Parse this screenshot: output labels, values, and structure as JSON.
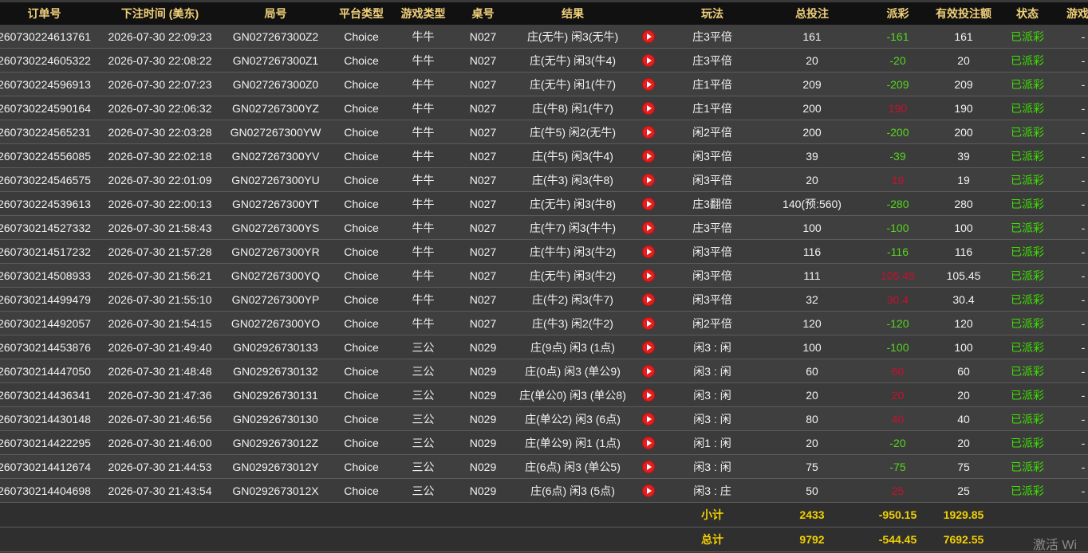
{
  "columns": [
    "订单号",
    "下注时间 (美东)",
    "局号",
    "平台类型",
    "游戏类型",
    "桌号",
    "结果",
    "",
    "玩法",
    "总投注",
    "派彩",
    "有效投注额",
    "状态",
    "游戏模"
  ],
  "rows": [
    {
      "order": "260730224613761",
      "time": "2026-07-30 22:09:23",
      "round": "GN027267300Z2",
      "platform": "Choice",
      "game": "牛牛",
      "table": "N027",
      "result": "庄(无牛) 闲3(无牛)",
      "play": "庄3平倍",
      "bet": "161",
      "payout": "-161",
      "payout_sign": "neg",
      "valid": "161",
      "status": "已派彩",
      "mode": "-"
    },
    {
      "order": "260730224605322",
      "time": "2026-07-30 22:08:22",
      "round": "GN027267300Z1",
      "platform": "Choice",
      "game": "牛牛",
      "table": "N027",
      "result": "庄(无牛) 闲3(牛4)",
      "play": "庄3平倍",
      "bet": "20",
      "payout": "-20",
      "payout_sign": "neg",
      "valid": "20",
      "status": "已派彩",
      "mode": "-"
    },
    {
      "order": "260730224596913",
      "time": "2026-07-30 22:07:23",
      "round": "GN027267300Z0",
      "platform": "Choice",
      "game": "牛牛",
      "table": "N027",
      "result": "庄(无牛) 闲1(牛7)",
      "play": "庄1平倍",
      "bet": "209",
      "payout": "-209",
      "payout_sign": "neg",
      "valid": "209",
      "status": "已派彩",
      "mode": "-"
    },
    {
      "order": "260730224590164",
      "time": "2026-07-30 22:06:32",
      "round": "GN027267300YZ",
      "platform": "Choice",
      "game": "牛牛",
      "table": "N027",
      "result": "庄(牛8) 闲1(牛7)",
      "play": "庄1平倍",
      "bet": "200",
      "payout": "190",
      "payout_sign": "pos",
      "valid": "190",
      "status": "已派彩",
      "mode": "-"
    },
    {
      "order": "260730224565231",
      "time": "2026-07-30 22:03:28",
      "round": "GN027267300YW",
      "platform": "Choice",
      "game": "牛牛",
      "table": "N027",
      "result": "庄(牛5) 闲2(无牛)",
      "play": "闲2平倍",
      "bet": "200",
      "payout": "-200",
      "payout_sign": "neg",
      "valid": "200",
      "status": "已派彩",
      "mode": "-"
    },
    {
      "order": "260730224556085",
      "time": "2026-07-30 22:02:18",
      "round": "GN027267300YV",
      "platform": "Choice",
      "game": "牛牛",
      "table": "N027",
      "result": "庄(牛5) 闲3(牛4)",
      "play": "闲3平倍",
      "bet": "39",
      "payout": "-39",
      "payout_sign": "neg",
      "valid": "39",
      "status": "已派彩",
      "mode": "-"
    },
    {
      "order": "260730224546575",
      "time": "2026-07-30 22:01:09",
      "round": "GN027267300YU",
      "platform": "Choice",
      "game": "牛牛",
      "table": "N027",
      "result": "庄(牛3) 闲3(牛8)",
      "play": "闲3平倍",
      "bet": "20",
      "payout": "19",
      "payout_sign": "pos",
      "valid": "19",
      "status": "已派彩",
      "mode": "-"
    },
    {
      "order": "260730224539613",
      "time": "2026-07-30 22:00:13",
      "round": "GN027267300YT",
      "platform": "Choice",
      "game": "牛牛",
      "table": "N027",
      "result": "庄(无牛) 闲3(牛8)",
      "play": "庄3翻倍",
      "bet": "140(预:560)",
      "payout": "-280",
      "payout_sign": "neg",
      "valid": "280",
      "status": "已派彩",
      "mode": "-"
    },
    {
      "order": "260730214527332",
      "time": "2026-07-30 21:58:43",
      "round": "GN027267300YS",
      "platform": "Choice",
      "game": "牛牛",
      "table": "N027",
      "result": "庄(牛7) 闲3(牛牛)",
      "play": "庄3平倍",
      "bet": "100",
      "payout": "-100",
      "payout_sign": "neg",
      "valid": "100",
      "status": "已派彩",
      "mode": "-"
    },
    {
      "order": "260730214517232",
      "time": "2026-07-30 21:57:28",
      "round": "GN027267300YR",
      "platform": "Choice",
      "game": "牛牛",
      "table": "N027",
      "result": "庄(牛牛) 闲3(牛2)",
      "play": "闲3平倍",
      "bet": "116",
      "payout": "-116",
      "payout_sign": "neg",
      "valid": "116",
      "status": "已派彩",
      "mode": "-"
    },
    {
      "order": "260730214508933",
      "time": "2026-07-30 21:56:21",
      "round": "GN027267300YQ",
      "platform": "Choice",
      "game": "牛牛",
      "table": "N027",
      "result": "庄(无牛) 闲3(牛2)",
      "play": "闲3平倍",
      "bet": "111",
      "payout": "105.45",
      "payout_sign": "pos",
      "valid": "105.45",
      "status": "已派彩",
      "mode": "-"
    },
    {
      "order": "260730214499479",
      "time": "2026-07-30 21:55:10",
      "round": "GN027267300YP",
      "platform": "Choice",
      "game": "牛牛",
      "table": "N027",
      "result": "庄(牛2) 闲3(牛7)",
      "play": "闲3平倍",
      "bet": "32",
      "payout": "30.4",
      "payout_sign": "pos",
      "valid": "30.4",
      "status": "已派彩",
      "mode": "-"
    },
    {
      "order": "260730214492057",
      "time": "2026-07-30 21:54:15",
      "round": "GN027267300YO",
      "platform": "Choice",
      "game": "牛牛",
      "table": "N027",
      "result": "庄(牛3) 闲2(牛2)",
      "play": "闲2平倍",
      "bet": "120",
      "payout": "-120",
      "payout_sign": "neg",
      "valid": "120",
      "status": "已派彩",
      "mode": "-"
    },
    {
      "order": "260730214453876",
      "time": "2026-07-30 21:49:40",
      "round": "GN02926730133",
      "platform": "Choice",
      "game": "三公",
      "table": "N029",
      "result": "庄(9点) 闲3 (1点)",
      "play": "闲3 : 闲",
      "bet": "100",
      "payout": "-100",
      "payout_sign": "neg",
      "valid": "100",
      "status": "已派彩",
      "mode": "-"
    },
    {
      "order": "260730214447050",
      "time": "2026-07-30 21:48:48",
      "round": "GN02926730132",
      "platform": "Choice",
      "game": "三公",
      "table": "N029",
      "result": "庄(0点) 闲3 (单公9)",
      "play": "闲3 : 闲",
      "bet": "60",
      "payout": "60",
      "payout_sign": "pos",
      "valid": "60",
      "status": "已派彩",
      "mode": "-"
    },
    {
      "order": "260730214436341",
      "time": "2026-07-30 21:47:36",
      "round": "GN02926730131",
      "platform": "Choice",
      "game": "三公",
      "table": "N029",
      "result": "庄(单公0) 闲3 (单公8)",
      "play": "闲3 : 闲",
      "bet": "20",
      "payout": "20",
      "payout_sign": "pos",
      "valid": "20",
      "status": "已派彩",
      "mode": "-"
    },
    {
      "order": "260730214430148",
      "time": "2026-07-30 21:46:56",
      "round": "GN02926730130",
      "platform": "Choice",
      "game": "三公",
      "table": "N029",
      "result": "庄(单公2) 闲3 (6点)",
      "play": "闲3 : 闲",
      "bet": "80",
      "payout": "40",
      "payout_sign": "pos",
      "valid": "40",
      "status": "已派彩",
      "mode": "-"
    },
    {
      "order": "260730214422295",
      "time": "2026-07-30 21:46:00",
      "round": "GN0292673012Z",
      "platform": "Choice",
      "game": "三公",
      "table": "N029",
      "result": "庄(单公9) 闲1 (1点)",
      "play": "闲1 : 闲",
      "bet": "20",
      "payout": "-20",
      "payout_sign": "neg",
      "valid": "20",
      "status": "已派彩",
      "mode": "-"
    },
    {
      "order": "260730214412674",
      "time": "2026-07-30 21:44:53",
      "round": "GN0292673012Y",
      "platform": "Choice",
      "game": "三公",
      "table": "N029",
      "result": "庄(6点) 闲3 (单公5)",
      "play": "闲3 : 闲",
      "bet": "75",
      "payout": "-75",
      "payout_sign": "neg",
      "valid": "75",
      "status": "已派彩",
      "mode": "-"
    },
    {
      "order": "260730214404698",
      "time": "2026-07-30 21:43:54",
      "round": "GN0292673012X",
      "platform": "Choice",
      "game": "三公",
      "table": "N029",
      "result": "庄(6点) 闲3 (5点)",
      "play": "闲3 : 庄",
      "bet": "50",
      "payout": "25",
      "payout_sign": "pos",
      "valid": "25",
      "status": "已派彩",
      "mode": "-"
    }
  ],
  "subtotal": {
    "label": "小计",
    "bet": "2433",
    "payout": "-950.15",
    "valid": "1929.85"
  },
  "total": {
    "label": "总计",
    "bet": "9792",
    "payout": "-544.45",
    "valid": "7692.55"
  },
  "watermark": "激活 Wi",
  "colors": {
    "header_text": "#f0d07a",
    "negative_payout": "#56d61c",
    "positive_payout": "#c8102e",
    "status": "#3ee000",
    "sum_text": "#f2d000"
  }
}
